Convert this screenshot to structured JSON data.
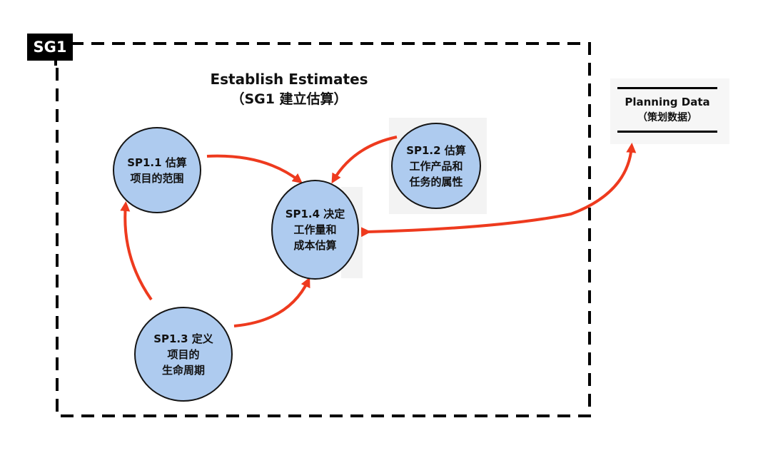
{
  "goal_tag": "SG1",
  "title": {
    "en": "Establish Estimates",
    "zh": "（SG1 建立估算）"
  },
  "nodes": {
    "sp11": {
      "line1": "SP1.1 估算",
      "line2": "项目的范围"
    },
    "sp12": {
      "line1": "SP1.2 估算",
      "line2": "工作产品和",
      "line3": "任务的属性"
    },
    "sp13": {
      "line1": "SP1.3 定义",
      "line2": "项目的",
      "line3": "生命周期"
    },
    "sp14": {
      "line1": "SP1.4 决定",
      "line2": "工作量和",
      "line3": "成本估算"
    }
  },
  "data_store": {
    "line1": "Planning Data",
    "line2": "（策划数据）"
  },
  "colors": {
    "node_fill": "#aecbef",
    "arrow": "#ee3a1e",
    "outline": "#000000"
  }
}
